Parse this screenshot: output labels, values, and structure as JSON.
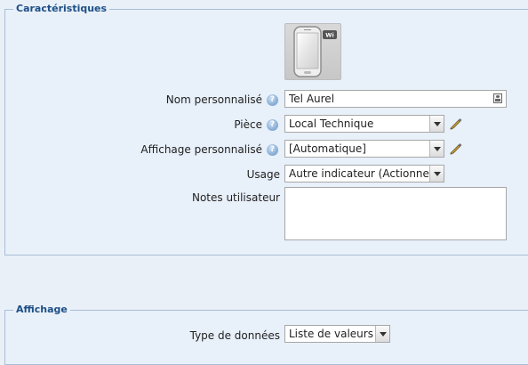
{
  "characteristics": {
    "legend": "Caractéristiques",
    "name_label": "Nom personnalisé",
    "name_value": "Tel Aurel",
    "room_label": "Pièce",
    "room_value": "Local Technique",
    "display_label": "Affichage personnalisé",
    "display_value": "[Automatique]",
    "usage_label": "Usage",
    "usage_value": "Autre indicateur (Actionneur)",
    "notes_label": "Notes utilisateur",
    "notes_value": ""
  },
  "display_section": {
    "legend": "Affichage",
    "data_type_label": "Type de données",
    "data_type_value": "Liste de valeurs"
  },
  "icons": {
    "help": "help-icon",
    "device": "smartphone-wifi-icon",
    "edit": "pencil-icon",
    "contact": "contact-card-icon"
  },
  "colors": {
    "background": "#e9f0f8",
    "legend_text": "#1d4f87",
    "border": "#a9bfd6"
  }
}
